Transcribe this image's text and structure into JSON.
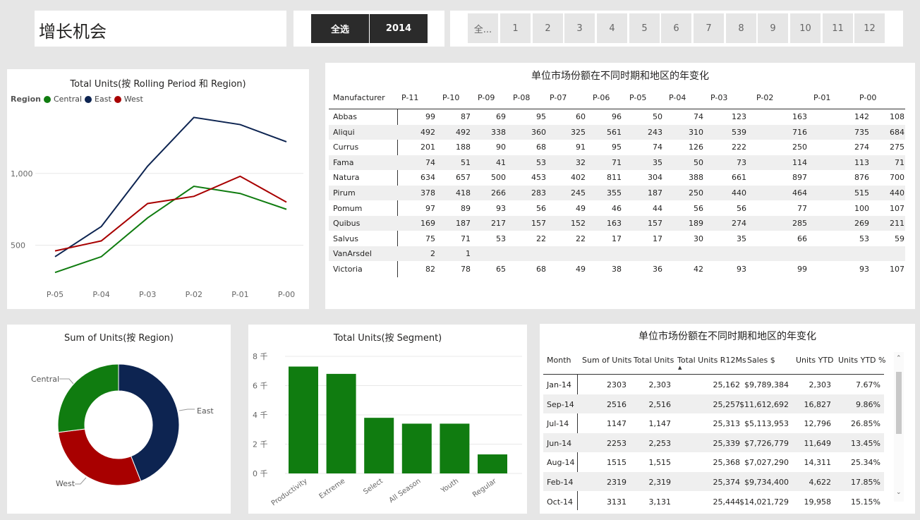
{
  "page": {
    "title": "增长机会"
  },
  "year_slicer": {
    "select_all": "全选",
    "year": "2014"
  },
  "month_slicer": {
    "items": [
      "全...",
      "1",
      "2",
      "3",
      "4",
      "5",
      "6",
      "7",
      "8",
      "9",
      "10",
      "11",
      "12"
    ]
  },
  "line_chart": {
    "title": "Total Units(按 Rolling Period 和 Region)",
    "legend_title": "Region",
    "legend": [
      {
        "name": "Central",
        "color": "#107c10"
      },
      {
        "name": "East",
        "color": "#0d2451"
      },
      {
        "name": "West",
        "color": "#a80000"
      }
    ],
    "y_ticks": [
      "1,000",
      "500"
    ],
    "x_ticks": [
      "P-05",
      "P-04",
      "P-03",
      "P-02",
      "P-01",
      "P-00"
    ]
  },
  "share_table": {
    "title": "单位市场份额在不同时期和地区的年变化",
    "columns": [
      "Manufacturer",
      "P-11",
      "P-10",
      "P-09",
      "P-08",
      "P-07",
      "P-06",
      "P-05",
      "P-04",
      "P-03",
      "P-02",
      "P-01",
      "P-00"
    ],
    "rows": [
      [
        "Abbas",
        "99",
        "87",
        "69",
        "95",
        "60",
        "96",
        "50",
        "74",
        "123",
        "163",
        "142",
        "108"
      ],
      [
        "Aliqui",
        "492",
        "492",
        "338",
        "360",
        "325",
        "561",
        "243",
        "310",
        "539",
        "716",
        "735",
        "684"
      ],
      [
        "Currus",
        "201",
        "188",
        "90",
        "68",
        "91",
        "95",
        "74",
        "126",
        "222",
        "250",
        "274",
        "275"
      ],
      [
        "Fama",
        "74",
        "51",
        "41",
        "53",
        "32",
        "71",
        "35",
        "50",
        "73",
        "114",
        "113",
        "71"
      ],
      [
        "Natura",
        "634",
        "657",
        "500",
        "453",
        "402",
        "811",
        "304",
        "388",
        "661",
        "897",
        "876",
        "700"
      ],
      [
        "Pirum",
        "378",
        "418",
        "266",
        "283",
        "245",
        "355",
        "187",
        "250",
        "440",
        "464",
        "515",
        "440"
      ],
      [
        "Pomum",
        "97",
        "89",
        "93",
        "56",
        "49",
        "46",
        "44",
        "56",
        "56",
        "77",
        "100",
        "107"
      ],
      [
        "Quibus",
        "169",
        "187",
        "217",
        "157",
        "152",
        "163",
        "157",
        "189",
        "274",
        "285",
        "269",
        "211"
      ],
      [
        "Salvus",
        "75",
        "71",
        "53",
        "22",
        "22",
        "17",
        "17",
        "30",
        "35",
        "66",
        "53",
        "59"
      ],
      [
        "VanArsdel",
        "2",
        "1",
        "",
        "",
        "",
        "",
        "",
        "",
        "",
        "",
        "",
        ""
      ],
      [
        "Victoria",
        "82",
        "78",
        "65",
        "68",
        "49",
        "38",
        "36",
        "42",
        "93",
        "99",
        "93",
        "107"
      ]
    ]
  },
  "donut_chart": {
    "title": "Sum of Units(按 Region)",
    "labels": [
      "Central",
      "East",
      "West"
    ]
  },
  "bar_chart": {
    "title": "Total Units(按 Segment)",
    "y_ticks": [
      "8 千",
      "6 千",
      "4 千",
      "2 千",
      "0 千"
    ]
  },
  "month_table": {
    "title": "单位市场份额在不同时期和地区的年变化",
    "columns": [
      "Month",
      "Sum of Units",
      "Total Units",
      "Total Units R12Ms",
      "Sales $",
      "Units YTD",
      "Units YTD %"
    ],
    "rows": [
      [
        "Jan-14",
        "2303",
        "2,303",
        "25,162",
        "$9,789,384",
        "2,303",
        "7.67%"
      ],
      [
        "Sep-14",
        "2516",
        "2,516",
        "25,257",
        "$11,612,692",
        "16,827",
        "9.86%"
      ],
      [
        "Jul-14",
        "1147",
        "1,147",
        "25,313",
        "$5,113,953",
        "12,796",
        "26.85%"
      ],
      [
        "Jun-14",
        "2253",
        "2,253",
        "25,339",
        "$7,726,779",
        "11,649",
        "13.45%"
      ],
      [
        "Aug-14",
        "1515",
        "1,515",
        "25,368",
        "$7,027,290",
        "14,311",
        "25.34%"
      ],
      [
        "Feb-14",
        "2319",
        "2,319",
        "25,374",
        "$9,734,400",
        "4,622",
        "17.85%"
      ],
      [
        "Oct-14",
        "3131",
        "3,131",
        "25,444",
        "$14,021,729",
        "19,958",
        "15.15%"
      ]
    ]
  },
  "chart_data": [
    {
      "type": "line",
      "title": "Total Units(按 Rolling Period 和 Region)",
      "x": [
        "P-05",
        "P-04",
        "P-03",
        "P-02",
        "P-01",
        "P-00"
      ],
      "ylim": [
        0,
        1400
      ],
      "series": [
        {
          "name": "Central",
          "color": "#107c10",
          "values": [
            310,
            420,
            690,
            910,
            860,
            750
          ]
        },
        {
          "name": "East",
          "color": "#0d2451",
          "values": [
            420,
            630,
            1050,
            1390,
            1340,
            1220
          ]
        },
        {
          "name": "West",
          "color": "#a80000",
          "values": [
            460,
            530,
            790,
            840,
            980,
            800
          ]
        }
      ]
    },
    {
      "type": "pie",
      "title": "Sum of Units(按 Region)",
      "labels": [
        "East",
        "West",
        "Central"
      ],
      "values": [
        44,
        29,
        27
      ],
      "colors": [
        "#0d2451",
        "#a80000",
        "#107c10"
      ]
    },
    {
      "type": "bar",
      "title": "Total Units(按 Segment)",
      "categories": [
        "Productivity",
        "Extreme",
        "Select",
        "All Season",
        "Youth",
        "Regular"
      ],
      "values": [
        7.3,
        6.8,
        3.8,
        3.4,
        3.4,
        1.3
      ],
      "ylabel": "千",
      "ylim": [
        0,
        8
      ],
      "color": "#107c10"
    }
  ]
}
